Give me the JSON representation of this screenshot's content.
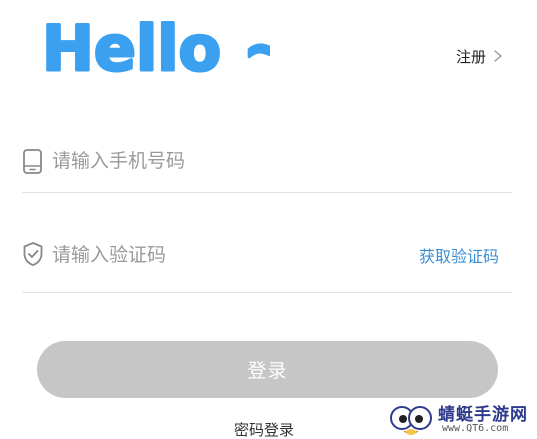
{
  "header": {
    "logo_text": "Hello ~",
    "register_label": "注册"
  },
  "form": {
    "phone_placeholder": "请输入手机号码",
    "phone_value": "",
    "code_placeholder": "请输入验证码",
    "code_value": "",
    "get_code_label": "获取验证码"
  },
  "actions": {
    "login_label": "登录",
    "password_login_label": "密码登录"
  },
  "watermark": {
    "site_name": "蜻蜓手游网",
    "site_url": "www.QT6.com"
  },
  "colors": {
    "logo_blue": "#3aa0ef",
    "link_blue": "#3b8fd4",
    "button_disabled": "#c6c6c6"
  },
  "icons": {
    "phone": "phone-icon",
    "shield": "shield-check-icon",
    "chevron": "chevron-right-icon",
    "mascot": "dragonfly-mascot-icon"
  }
}
